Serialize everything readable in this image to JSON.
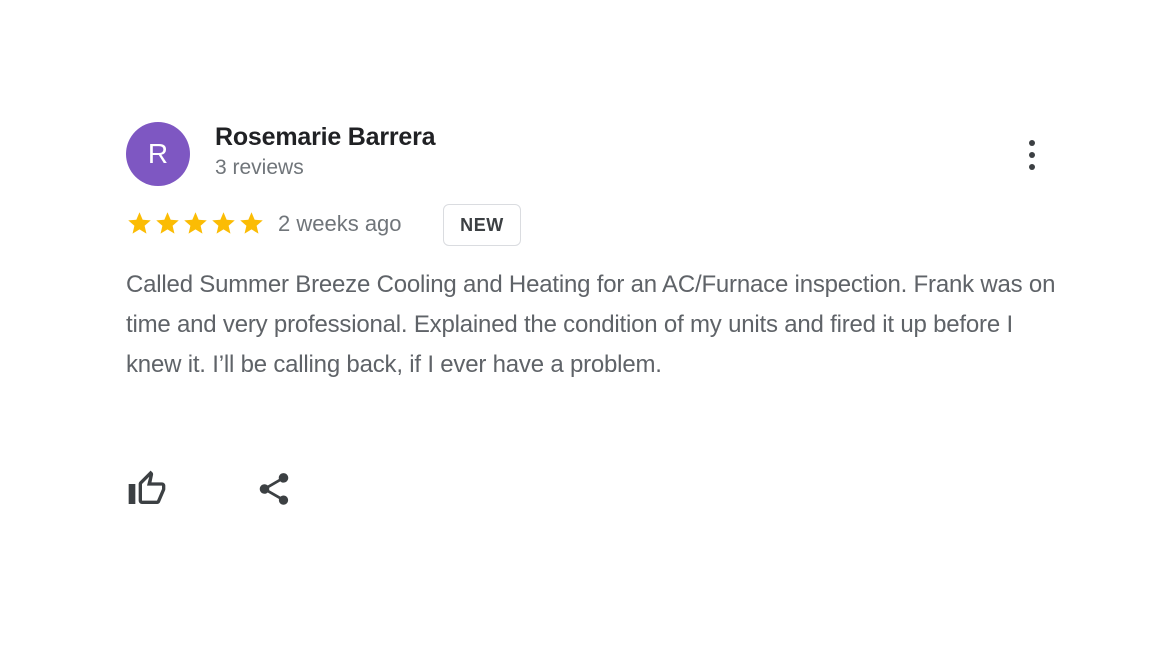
{
  "review": {
    "author": {
      "initial": "R",
      "name": "Rosemarie Barrera",
      "meta": "3 reviews",
      "avatar_color": "#7e57c2"
    },
    "rating": 5,
    "rating_max": 5,
    "star_color": "#fbbc04",
    "time_ago": "2 weeks ago",
    "badge": "NEW",
    "text": "Called Summer Breeze Cooling and Heating for an AC/Furnace inspection. Frank was on time and very professional. Explained the condition of my units and fired it up before I knew it. I’ll be calling back, if I ever have a problem.",
    "actions": {
      "like_icon": "thumb-up-icon",
      "share_icon": "share-icon"
    },
    "menu_icon": "more-vert-icon"
  }
}
